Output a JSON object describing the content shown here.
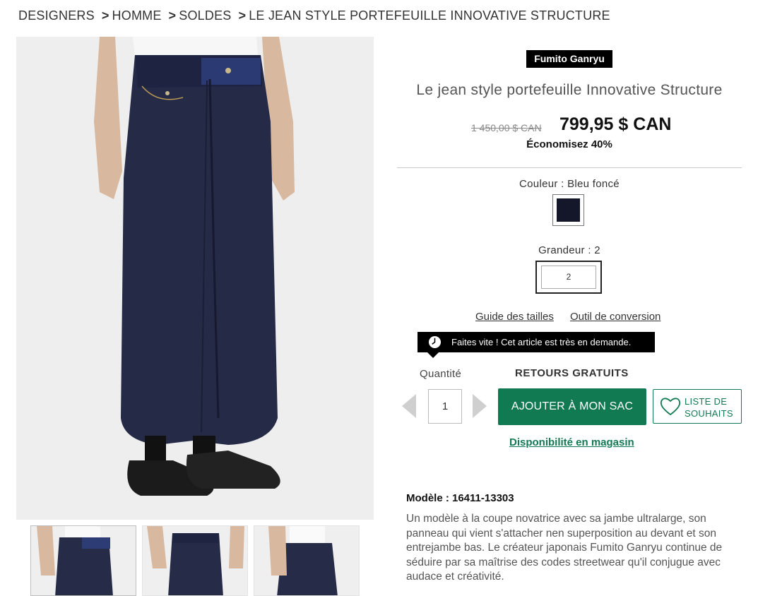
{
  "breadcrumb": {
    "items": [
      "DESIGNERS",
      "HOMME",
      "SOLDES",
      "LE JEAN STYLE PORTEFEUILLE INNOVATIVE STRUCTURE"
    ],
    "separator": ">"
  },
  "product": {
    "brand": "Fumito Ganryu",
    "title": "Le jean style portefeuille Innovative Structure",
    "original_price": "1 450,00 $ CAN",
    "sale_price": "799,95 $ CAN",
    "savings": "Économisez 40%",
    "color_label": "Couleur : Bleu foncé",
    "size_label": "Grandeur : 2",
    "size_option": "2",
    "size_guide_link": "Guide des tailles",
    "conversion_link": "Outil de conversion",
    "demand_message": "Faites vite ! Cet article est très en demande.",
    "quantity_label": "Quantité",
    "quantity_value": "1",
    "free_returns": "RETOURS GRATUITS",
    "add_to_bag": "AJOUTER À MON SAC",
    "wishlist_line1": "LISTE DE",
    "wishlist_line2": "SOUHAITS",
    "availability_link": "Disponibilité en magasin",
    "model_line": "Modèle : 16411-13303",
    "description": "Un modèle à la coupe novatrice avec sa jambe ultralarge, son panneau qui vient s'attacher nen superposition au devant et son entrejambe bas. Le créateur japonais Fumito Ganryu continue de séduire par sa maîtrise des codes streetwear qu'il conjugue avec audace et créativité."
  },
  "colors": {
    "accent": "#127a53",
    "swatch": "#14162a",
    "badge_bg": "#000000"
  },
  "icons": {
    "clock": "clock-icon",
    "heart": "heart-icon",
    "qty_dec": "arrow-left-icon",
    "qty_inc": "arrow-right-icon"
  }
}
